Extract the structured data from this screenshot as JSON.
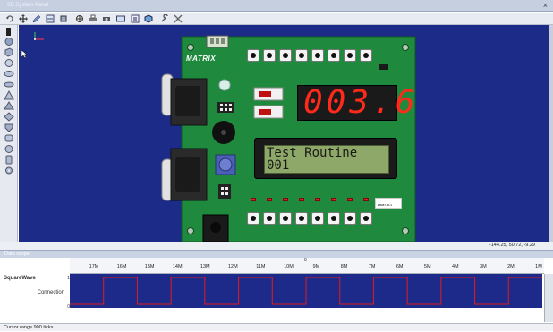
{
  "window": {
    "title": "3D System Panel",
    "close_glyph": "×"
  },
  "toolbar": {
    "icons": [
      "undo-icon",
      "move-icon",
      "pencil-icon",
      "wire-icon",
      "component-icon",
      "pan-icon",
      "print-icon",
      "camera-icon",
      "view-icon",
      "box-icon",
      "cube-icon",
      "wrench-icon",
      "tools-icon"
    ]
  },
  "board": {
    "brand": "MATRIX",
    "display_digits": "003.6",
    "lcd_line1": "Test Routine",
    "lcd_line2": "001",
    "board_code": "EB087-00-1"
  },
  "colors": {
    "panel_background": "#1c2a88",
    "pcb_green": "#1f8a3e",
    "seven_segment_red": "#ff2a1a",
    "lcd_green": "#8ea86a",
    "scope_trace": "#e01c1c"
  },
  "coords_readout": "-144.25, 50.72, -9.29",
  "scope": {
    "title": "Data scope",
    "series_name": "SquareWave",
    "trace_label": "Connection",
    "high_label": "1",
    "low_label": "0",
    "ticks": [
      "17M",
      "16M",
      "15M",
      "14M",
      "13M",
      "12M",
      "11M",
      "10M",
      "9M",
      "8M",
      "7M",
      "6M",
      "5M",
      "4M",
      "3M",
      "2M",
      "1M"
    ],
    "marker": "0"
  },
  "status": {
    "text": "Cursor range 900 ticks"
  },
  "chart_data": {
    "type": "line",
    "title": "",
    "series": [
      {
        "name": "SquareWave",
        "values": [
          0,
          1,
          0,
          1,
          0,
          1,
          0,
          1,
          0,
          1,
          0,
          1,
          0,
          1
        ]
      }
    ],
    "x_ticks": [
      "17M",
      "16M",
      "15M",
      "14M",
      "13M",
      "12M",
      "11M",
      "10M",
      "9M",
      "8M",
      "7M",
      "6M",
      "5M",
      "4M",
      "3M",
      "2M",
      "1M"
    ],
    "ylim": [
      0,
      1
    ]
  }
}
